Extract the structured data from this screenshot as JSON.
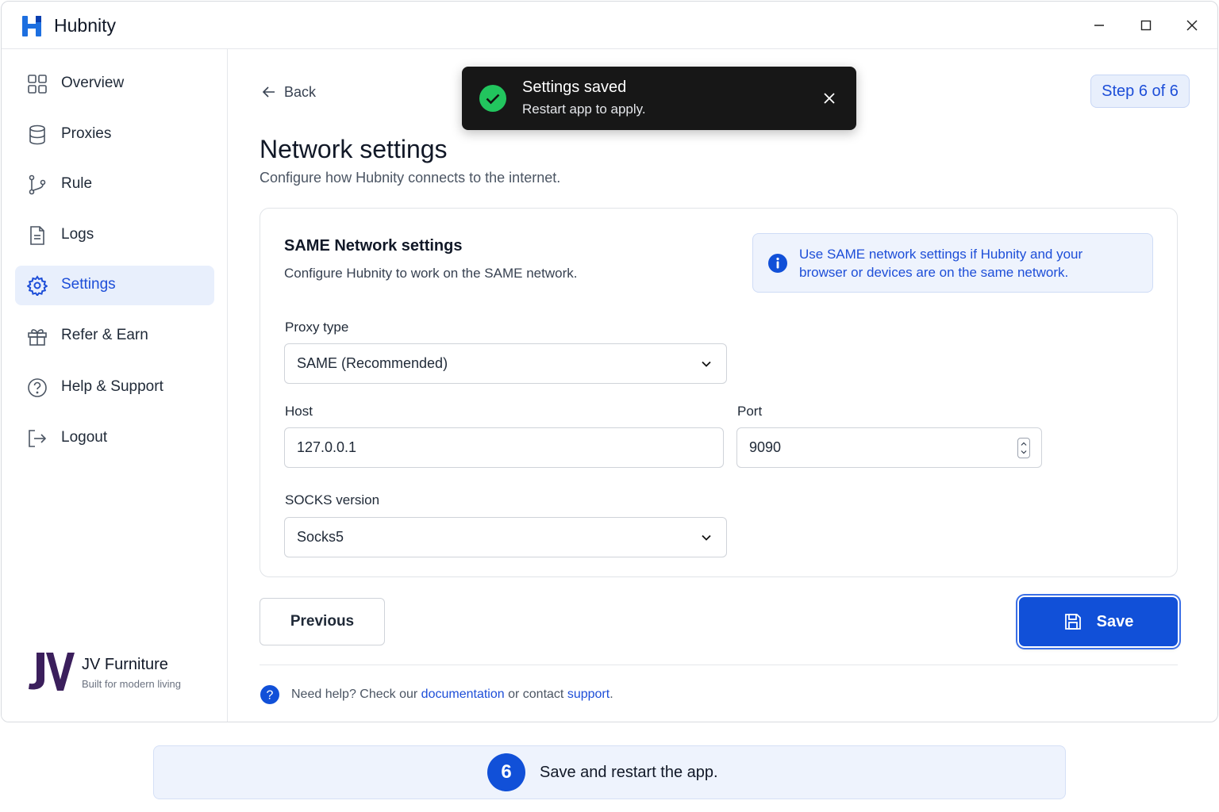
{
  "app": {
    "title": "Hubnity"
  },
  "sidebar": {
    "items": [
      {
        "label": "Overview",
        "icon": "grid-icon"
      },
      {
        "label": "Proxies",
        "icon": "database-icon"
      },
      {
        "label": "Rule",
        "icon": "git-branch-icon"
      },
      {
        "label": "Logs",
        "icon": "document-icon"
      },
      {
        "label": "Settings",
        "icon": "gear-icon",
        "active": true
      },
      {
        "label": "Refer & Earn",
        "icon": "gift-icon"
      },
      {
        "label": "Help & Support",
        "icon": "help-circle-icon"
      },
      {
        "label": "Logout",
        "icon": "logout-icon"
      }
    ],
    "brand": {
      "name": "JV Furniture",
      "tagline": "Built for modern living"
    }
  },
  "header": {
    "back_label": "Back",
    "step_chip": "Step 6 of 6",
    "title": "Network settings",
    "subtitle": "Configure how Hubnity connects to the internet."
  },
  "card": {
    "title": "SAME Network settings",
    "subtitle": "Configure Hubnity to work on the SAME network.",
    "info": "Use SAME network settings if Hubnity and your browser or devices are on the same network.",
    "proxy_type": {
      "label": "Proxy type",
      "value": "SAME (Recommended)"
    },
    "host": {
      "label": "Host",
      "value": "127.0.0.1"
    },
    "port": {
      "label": "Port",
      "value": "9090"
    },
    "socks": {
      "label": "SOCKS version",
      "value": "Socks5"
    }
  },
  "actions": {
    "previous_label": "Previous",
    "save_label": "Save"
  },
  "help": {
    "prefix": "Need help? Check our",
    "documentation": "documentation",
    "middle": "or contact",
    "support": "support",
    "suffix": "."
  },
  "toast": {
    "title": "Settings saved",
    "message": "Restart app to apply."
  },
  "step_banner": {
    "number": "6",
    "text": "Save and restart the app."
  },
  "colors": {
    "accent": "#1150d8",
    "accent_light": "#e8effc",
    "success": "#22c55e",
    "toast_bg": "#171717"
  }
}
